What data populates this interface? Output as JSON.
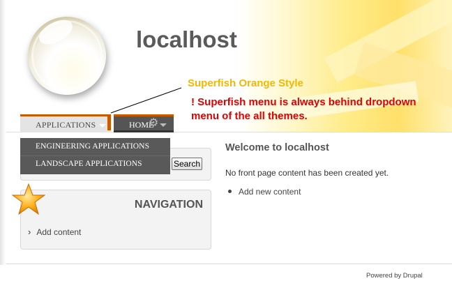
{
  "site": {
    "name": "localhost"
  },
  "annotation": {
    "title": "Superfish Orange Style",
    "note_line1": "! Superfish menu is always behind dropdown",
    "note_line2": "menu of the all themes."
  },
  "menu": {
    "applications_label": "APPLICATIONS",
    "home_label": "HOME",
    "dropdown_items": [
      "ENGINEERING APPLICATIONS",
      "LANDSCAPE APPLICATIONS"
    ]
  },
  "search": {
    "button_label": "Search"
  },
  "navigation": {
    "title": "NAVIGATION",
    "items": [
      {
        "label": "Add content"
      }
    ]
  },
  "content": {
    "title": "Welcome to localhost",
    "text": "No front page content has been created yet.",
    "links": [
      {
        "label": "Add new content"
      }
    ]
  },
  "footer": {
    "text": "Powered by Drupal"
  },
  "colors": {
    "accent_orange": "#c85a00",
    "annotation_yellow": "#f3b800",
    "annotation_red": "#e00000",
    "menu_dark": "#595959"
  }
}
